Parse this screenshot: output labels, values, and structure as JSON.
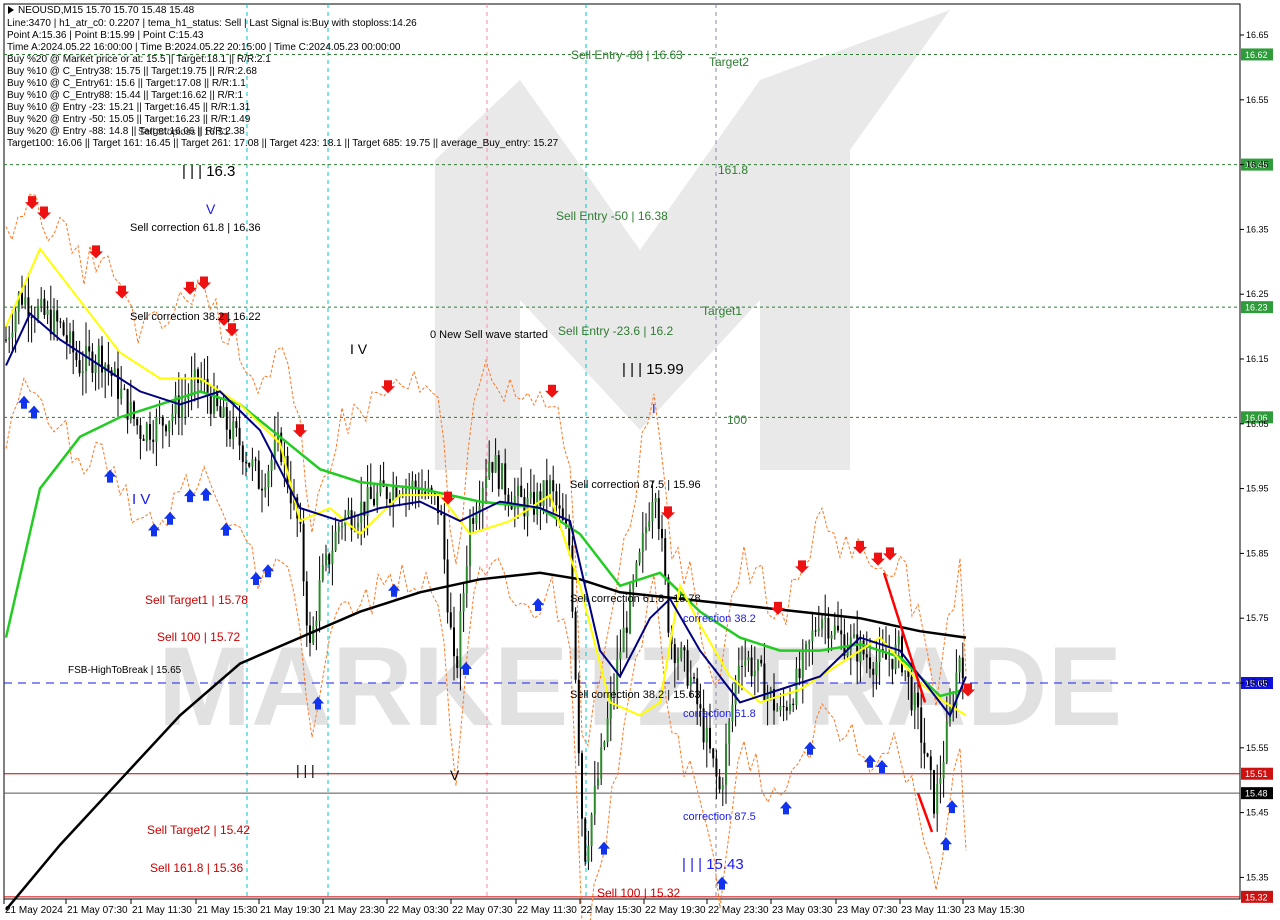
{
  "header": {
    "symbol_line": "NEOUSD,M15  15.70 15.70 15.48 15.48",
    "lines": [
      "Line:3470  |  h1_atr_c0: 0.2207  |  tema_h1_status: Sell  |  Last Signal is:Buy with stoploss:14.26",
      "Point A:15.36  |  Point B:15.99  |  Point C:15.43",
      "Time A:2024.05.22 16:00:00  |  Time B:2024.05.22 20:15:00  |  Time C:2024.05.23 00:00:00",
      "Buy %20 @ Market price or at: 15.5  ||  Target:18.1  ||  R/R:2.1",
      "Buy %10 @ C_Entry38: 15.75  ||  Target:19.75  ||  R/R:2.68",
      "Buy %10 @ C_Entry61: 15.6  ||  Target:17.08  ||  R/R:1.1",
      "Buy %10 @ C_Entry88: 15.44  ||  Target:16.62  ||  R/R:1",
      "Buy %10 @ Entry -23: 15.21  ||  Target:16.45  ||  R/R:1.31",
      "Buy %20 @ Entry -50: 15.05  ||  Target:16.23  ||  R/R:1.49",
      "Buy %20 @ Entry -88: 14.8  ||  Target:16.06  ||  R/R:2.38",
      "Target100: 16.06  ||  Target 161: 16.45  ||  Target 261: 17.08  ||  Target 423: 18.1  ||  Target 685: 19.75  ||  average_Buy_entry: 15.27"
    ],
    "overlap_text": "Sell Stoploss | 16.51"
  },
  "colors": {
    "green_line": "#2e7d32",
    "blue_dash": "#1a1aee",
    "red_line": "#cc0000",
    "ma_black": "#000000",
    "ma_green": "#22cc22",
    "ma_yellow": "#ffff00",
    "ma_navy": "#000080",
    "candle": "#000000",
    "label_green_bg": "#2e9c3a",
    "label_red_bg": "#cc1111",
    "label_blue_bg": "#1111dd",
    "label_black_bg": "#000000"
  },
  "chart_data": {
    "type": "candlestick",
    "symbol": "NEOUSD",
    "timeframe": "M15",
    "ylim": [
      15.3,
      16.7
    ],
    "y_ticks": [
      "16.65",
      "16.55",
      "16.45",
      "16.35",
      "16.25",
      "16.15",
      "16.05",
      "15.95",
      "15.85",
      "15.75",
      "15.65",
      "15.55",
      "15.45",
      "15.35"
    ],
    "x_ticks": [
      "21 May 2024",
      "21 May 07:30",
      "21 May 11:30",
      "21 May 15:30",
      "21 May 19:30",
      "21 May 23:30",
      "22 May 03:30",
      "22 May 07:30",
      "22 May 11:30",
      "22 May 15:30",
      "22 May 19:30",
      "22 May 23:30",
      "23 May 03:30",
      "23 May 07:30",
      "23 May 11:30",
      "23 May 15:30"
    ],
    "levels": [
      {
        "price": 16.62,
        "label": "16.62",
        "kind": "green"
      },
      {
        "price": 16.45,
        "label": "16.45",
        "kind": "green"
      },
      {
        "price": 16.23,
        "label": "16.23",
        "kind": "green"
      },
      {
        "price": 16.06,
        "label": "16.06",
        "kind": "green"
      },
      {
        "price": 15.65,
        "label": "15.65",
        "kind": "blue"
      },
      {
        "price": 15.51,
        "label": "15.51",
        "kind": "red"
      },
      {
        "price": 15.48,
        "label": "15.48",
        "kind": "black"
      },
      {
        "price": 15.32,
        "label": "15.32",
        "kind": "red"
      }
    ],
    "annotations": [
      {
        "text": "Sell Entry -88 | 16.63",
        "color": "#2e7d32"
      },
      {
        "text": "Target2",
        "color": "#2e7d32"
      },
      {
        "text": "161.8",
        "color": "#2e7d32"
      },
      {
        "text": "Sell Entry -50 | 16.38",
        "color": "#2e7d32"
      },
      {
        "text": "Target1",
        "color": "#2e7d32"
      },
      {
        "text": "Sell Entry -23.6 | 16.2",
        "color": "#2e7d32"
      },
      {
        "text": "100",
        "color": "#2e7d32"
      },
      {
        "text": "| | | 16.3",
        "color": "#000000"
      },
      {
        "text": "V",
        "color": "#1a1aee"
      },
      {
        "text": "Sell correction 61.8 | 16.36",
        "color": "#000000"
      },
      {
        "text": "Sell correction 38.2 | 16.22",
        "color": "#000000"
      },
      {
        "text": "0 New Sell wave started",
        "color": "#000000"
      },
      {
        "text": "I V",
        "color": "#000000"
      },
      {
        "text": "| | | 15.99",
        "color": "#000000"
      },
      {
        "text": "I",
        "color": "#1a1aee"
      },
      {
        "text": "Sell correction 87.5 | 15.96",
        "color": "#000000"
      },
      {
        "text": "I V",
        "color": "#1a1aee"
      },
      {
        "text": "Sell Target1 | 15.78",
        "color": "#cc0000"
      },
      {
        "text": "Sell 100 | 15.72",
        "color": "#cc0000"
      },
      {
        "text": "Sell correction 61.8 | 15.78",
        "color": "#000000"
      },
      {
        "text": "correction 38.2",
        "color": "#1a1aee"
      },
      {
        "text": "FSB-HighToBreak | 15.65",
        "color": "#000000"
      },
      {
        "text": "Sell correction 38.2 | 15.63",
        "color": "#000000"
      },
      {
        "text": "correction 61.8",
        "color": "#1a1aee"
      },
      {
        "text": "| | |",
        "color": "#000000"
      },
      {
        "text": "V",
        "color": "#000000"
      },
      {
        "text": "Sell Target2 | 15.42",
        "color": "#cc0000"
      },
      {
        "text": "correction 87.5",
        "color": "#1a1aee"
      },
      {
        "text": "Sell 161.8 | 15.36",
        "color": "#cc0000"
      },
      {
        "text": "| | | 15.43",
        "color": "#1a1aee"
      },
      {
        "text": "Sell 100 | 15.32",
        "color": "#cc0000"
      }
    ],
    "watermark": "MARKETZITRADE"
  }
}
